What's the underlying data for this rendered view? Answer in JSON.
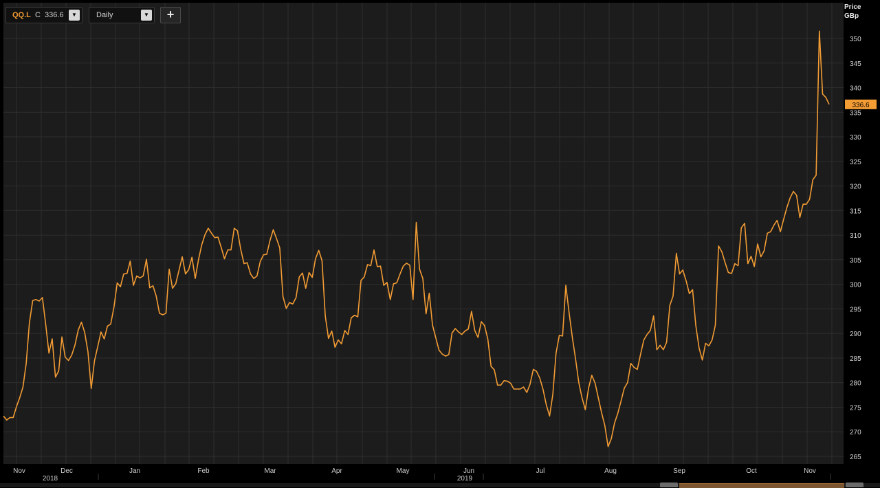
{
  "toolbar": {
    "ric": "QQ.L",
    "close_prefix": "C",
    "close_value": "336.6",
    "interval": "Daily",
    "add_label": "+"
  },
  "axis": {
    "price_label": "Price",
    "unit_label": "GBp"
  },
  "colors": {
    "line": "#f39c34",
    "grid": "#2e2e2e",
    "panel": "#1c1c1c",
    "marker_text": "#000000"
  },
  "chart_data": {
    "type": "line",
    "title": "",
    "series": [
      {
        "name": "QQ.L",
        "values": [
          273.2,
          272.4,
          272.9,
          272.9,
          275.1,
          276.9,
          279.1,
          283.9,
          292.2,
          296.7,
          296.9,
          296.6,
          297.3,
          291.8,
          286.0,
          288.9,
          281.1,
          282.4,
          289.3,
          285.2,
          284.5,
          285.6,
          287.6,
          290.7,
          292.3,
          290.2,
          286.3,
          278.8,
          284.4,
          287.3,
          290.3,
          288.9,
          291.5,
          291.9,
          295.4,
          300.3,
          299.5,
          302.1,
          302.2,
          304.7,
          299.8,
          301.7,
          301.3,
          301.7,
          305.1,
          299.3,
          299.7,
          297.6,
          294.1,
          293.8,
          294.1,
          303.1,
          299.2,
          300.1,
          302.8,
          305.6,
          302.1,
          303.0,
          305.5,
          301.2,
          305.0,
          308.0,
          310.1,
          311.4,
          310.4,
          309.5,
          309.6,
          307.5,
          305.2,
          307.0,
          307.0,
          311.4,
          310.9,
          307.1,
          304.2,
          304.4,
          302.1,
          301.2,
          301.7,
          304.6,
          306.0,
          306.1,
          308.9,
          311.1,
          309.3,
          307.4,
          297.5,
          295.1,
          296.3,
          296.0,
          297.3,
          301.5,
          302.3,
          299.2,
          302.4,
          301.4,
          305.2,
          306.9,
          304.8,
          293.6,
          289.0,
          290.5,
          287.2,
          288.7,
          287.9,
          290.6,
          289.8,
          293.2,
          293.7,
          293.4,
          300.8,
          301.5,
          304.0,
          303.8,
          307.0,
          303.6,
          303.7,
          299.8,
          300.4,
          296.9,
          300.1,
          300.3,
          302.1,
          303.7,
          304.3,
          303.9,
          296.9,
          312.6,
          303.1,
          301.2,
          294.0,
          298.2,
          291.7,
          289.1,
          286.6,
          285.8,
          285.4,
          285.7,
          290.1,
          291.0,
          290.3,
          289.8,
          290.5,
          290.9,
          294.5,
          290.6,
          289.2,
          292.4,
          291.6,
          288.9,
          283.3,
          282.6,
          279.5,
          279.5,
          280.4,
          280.3,
          279.9,
          278.7,
          278.7,
          278.7,
          279.1,
          278.0,
          279.7,
          282.7,
          282.3,
          280.9,
          278.6,
          275.5,
          273.2,
          277.6,
          286.0,
          289.6,
          289.5,
          299.8,
          294.3,
          289.2,
          284.8,
          280.0,
          276.9,
          274.5,
          278.9,
          281.5,
          279.9,
          276.9,
          273.9,
          271.3,
          267.0,
          268.6,
          271.8,
          273.8,
          276.3,
          278.9,
          280.0,
          283.9,
          283.1,
          282.7,
          285.8,
          288.7,
          289.8,
          290.6,
          293.6,
          286.7,
          287.6,
          286.7,
          288.2,
          295.7,
          297.6,
          306.3,
          302.1,
          302.9,
          300.7,
          298.1,
          298.9,
          291.6,
          287.0,
          284.6,
          288.0,
          287.5,
          288.7,
          291.7,
          307.8,
          306.6,
          304.4,
          302.4,
          302.2,
          304.2,
          303.8,
          311.5,
          312.4,
          304.2,
          305.7,
          303.6,
          308.2,
          305.6,
          306.8,
          310.4,
          310.7,
          312.0,
          313.0,
          310.7,
          313.2,
          315.6,
          317.6,
          318.9,
          318.1,
          313.6,
          316.3,
          316.3,
          317.3,
          321.3,
          322.2,
          351.5,
          338.7,
          338.0,
          336.6
        ],
        "last_value": "336.6"
      }
    ],
    "x_labels": [
      "Nov",
      "Dec",
      "Jan",
      "Feb",
      "Mar",
      "Apr",
      "May",
      "Jun",
      "Jul",
      "Aug",
      "Sep",
      "Oct",
      "Nov"
    ],
    "year_labels": [
      "2018",
      "2019"
    ],
    "y_ticks": [
      265,
      270,
      275,
      280,
      285,
      290,
      295,
      300,
      305,
      310,
      315,
      320,
      325,
      330,
      335,
      340,
      345,
      350
    ],
    "ylim": [
      264,
      354
    ],
    "grid": true,
    "legend": "none"
  }
}
